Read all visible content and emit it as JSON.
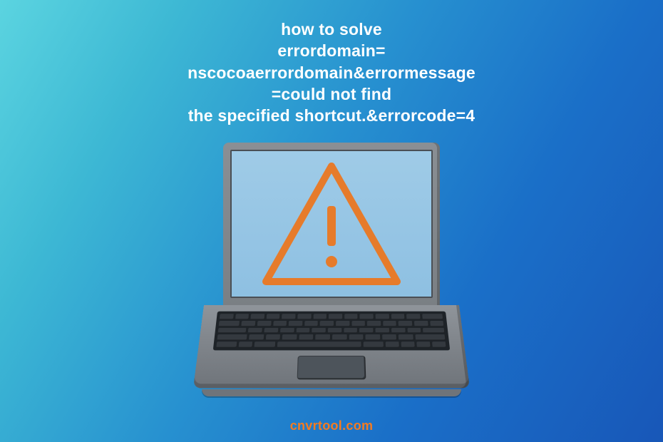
{
  "title": {
    "line1": "how to solve",
    "line2": "errordomain=",
    "line3": "nscocoaerrordomain&errormessage",
    "line4": "=could not find",
    "line5": "the specified shortcut.&errorcode=4"
  },
  "footer": "cnvrtool.com",
  "icons": {
    "warning": "warning-triangle-exclamation"
  },
  "colors": {
    "warning": "#E67B2B",
    "text": "#FFFFFF",
    "footer": "#F47B20"
  }
}
